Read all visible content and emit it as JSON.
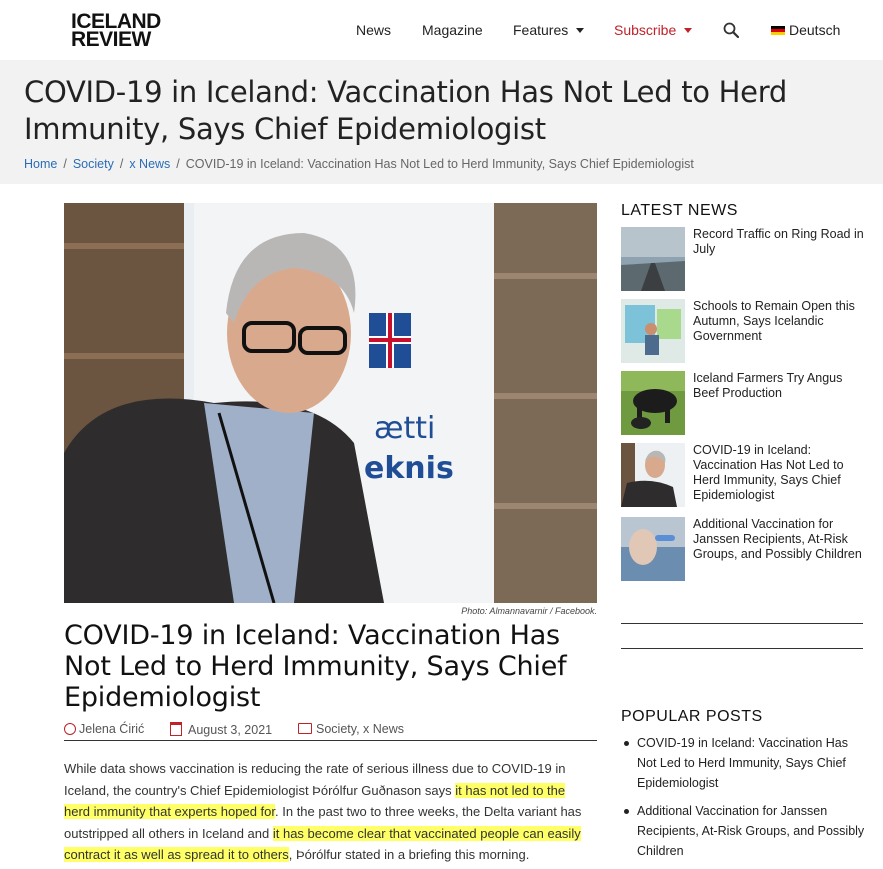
{
  "brand": {
    "line1": "ICELAND",
    "line2": "REVIEW"
  },
  "nav": {
    "news": "News",
    "magazine": "Magazine",
    "features": "Features",
    "subscribe": "Subscribe",
    "language": "Deutsch",
    "accent_color": "#c0222a"
  },
  "page": {
    "title": "COVID-19 in Iceland: Vaccination Has Not Led to Herd Immunity, Says Chief Epidemiologist"
  },
  "breadcrumb": {
    "home": "Home",
    "society": "Society",
    "news": "x News",
    "current": "COVID-19 in Iceland: Vaccination Has Not Led to Herd Immunity, Says Chief Epidemiologist"
  },
  "hero": {
    "credit": "Photo: Almannavarnir / Facebook."
  },
  "article": {
    "title": "COVID-19 in Iceland: Vaccination Has Not Led to Herd Immunity, Says Chief Epidemiologist",
    "author": "Jelena Ćirić",
    "date": "August 3, 2021",
    "categories": "Society, x News",
    "p1_a": "While data shows vaccination is reducing the rate of serious illness due to COVID-19 in Iceland, the country's Chief Epidemiologist Þórólfur Guðnason says ",
    "p1_hl1": "it has not led to the herd immunity that experts hoped for",
    "p1_b": ". In the past two to three weeks, the Delta variant has outstripped all others in Iceland and ",
    "p1_hl2": "it has become clear that vaccinated people can easily contract it as well as spread it to others",
    "p1_c": ", Þórólfur stated in a briefing this morning."
  },
  "sidebar": {
    "latest_heading": "LATEST NEWS",
    "latest": [
      {
        "title": "Record Traffic on Ring Road in July"
      },
      {
        "title": "Schools to Remain Open this Autumn, Says Icelandic Government"
      },
      {
        "title": "Iceland Farmers Try Angus Beef Production"
      },
      {
        "title": "COVID-19 in Iceland: Vaccination Has Not Led to Herd Immunity, Says Chief Epidemiologist"
      },
      {
        "title": "Additional Vaccination for Janssen Recipients, At-Risk Groups, and Possibly Children"
      }
    ],
    "popular_heading": "POPULAR POSTS",
    "popular": [
      {
        "title": "COVID-19 in Iceland: Vaccination Has Not Led to Herd Immunity, Says Chief Epidemiologist"
      },
      {
        "title": "Additional Vaccination for Janssen Recipients, At-Risk Groups, and Possibly Children"
      }
    ]
  }
}
